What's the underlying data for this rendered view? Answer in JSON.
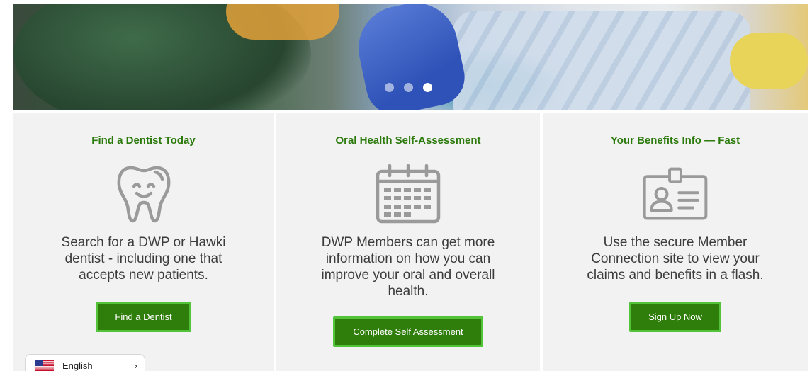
{
  "hero": {
    "slides": 3,
    "active_slide": 3
  },
  "panels": [
    {
      "title": "Find a Dentist Today",
      "icon": "tooth-icon",
      "description": "Search for a DWP or Hawki dentist - including one that accepts new patients.",
      "button": "Find a Dentist"
    },
    {
      "title": "Oral Health Self-Assessment",
      "icon": "calendar-icon",
      "description": "DWP Members can get more information on how you can improve your oral and overall health.",
      "button": "Complete Self Assessment"
    },
    {
      "title": "Your Benefits Info — Fast",
      "icon": "id-card-icon",
      "description": "Use the secure Member Connection site to view your claims and benefits in a flash.",
      "button": "Sign Up Now"
    }
  ],
  "language": {
    "label": "English",
    "flag": "us-flag-icon",
    "chevron": "chevron-right-icon"
  },
  "colors": {
    "accent": "#2b7a0b",
    "button_bg": "#2f7d0a",
    "button_border": "#53c43a",
    "panel_bg": "#f2f2f2",
    "icon_gray": "#9a9a9a"
  }
}
